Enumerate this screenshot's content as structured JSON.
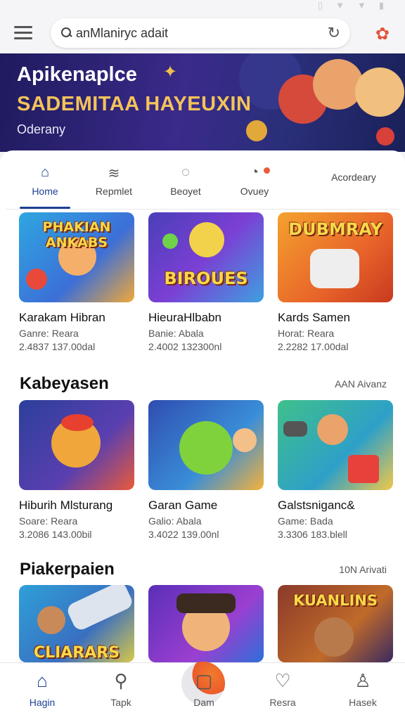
{
  "search": {
    "placeholder": "",
    "value": "anMlaniryc adait"
  },
  "banner": {
    "title": "Apikenaplce",
    "subtitle": "SADEMITAA HAYEUXIN",
    "caption": "Oderany"
  },
  "tabs": [
    {
      "label": "Home",
      "icon": "home-icon",
      "active": true
    },
    {
      "label": "Repmlet",
      "icon": "wifi-icon",
      "active": false
    },
    {
      "label": "Beoyet",
      "icon": "chat-icon",
      "active": false
    },
    {
      "label": "Ovuey",
      "icon": "controller-icon",
      "active": false,
      "badge": true
    },
    {
      "label": "Acordeary",
      "icon": "",
      "active": false
    }
  ],
  "sections": [
    {
      "title": "",
      "link": "",
      "games": [
        {
          "name": "Karakam Hibran",
          "genre": "Ganre: Reara",
          "stats": "2.4837 137.00dal",
          "thumb_text": "PHAKIAN ANKABS"
        },
        {
          "name": "HieuraHlbabn",
          "genre": "Banie: Abala",
          "stats": "2.4002 132300nl",
          "thumb_text": "BIROUES"
        },
        {
          "name": "Kards Samen",
          "genre": "Horat: Reara",
          "stats": "2.2282 17.00dal",
          "thumb_text": "DUBMRAY"
        }
      ]
    },
    {
      "title": "Kabeyasen",
      "link": "AAN Aivanz",
      "games": [
        {
          "name": "Hiburih Mlsturang",
          "genre": "Soare: Reara",
          "stats": "3.2086 143.00bil",
          "thumb_text": ""
        },
        {
          "name": "Garan Game",
          "genre": "Galio: Abala",
          "stats": "3.4022 139.00nl",
          "thumb_text": ""
        },
        {
          "name": "Galstsniganc&",
          "genre": "Game: Bada",
          "stats": "3.3306 183.blell",
          "thumb_text": ""
        }
      ]
    },
    {
      "title": "Piakerpaien",
      "link": "10N Arivati",
      "games": [
        {
          "name": "",
          "genre": "",
          "stats": "",
          "thumb_text": "CLIARARS"
        },
        {
          "name": "",
          "genre": "",
          "stats": "",
          "thumb_text": ""
        },
        {
          "name": "",
          "genre": "",
          "stats": "",
          "thumb_text": "KUANLINS"
        }
      ]
    }
  ],
  "bottom_nav": [
    {
      "label": "Hagin",
      "icon": "home-icon",
      "active": true
    },
    {
      "label": "Tapk",
      "icon": "search-icon",
      "active": false
    },
    {
      "label": "Dam",
      "icon": "box-icon",
      "active": false
    },
    {
      "label": "Resra",
      "icon": "heart-icon",
      "active": false
    },
    {
      "label": "Hasek",
      "icon": "user-icon",
      "active": false
    }
  ],
  "colors": {
    "accent": "#1e3f94",
    "banner_bg": "#2a2a7a",
    "badge": "#ec5b3b",
    "banner_subtitle": "#f4c35a"
  }
}
